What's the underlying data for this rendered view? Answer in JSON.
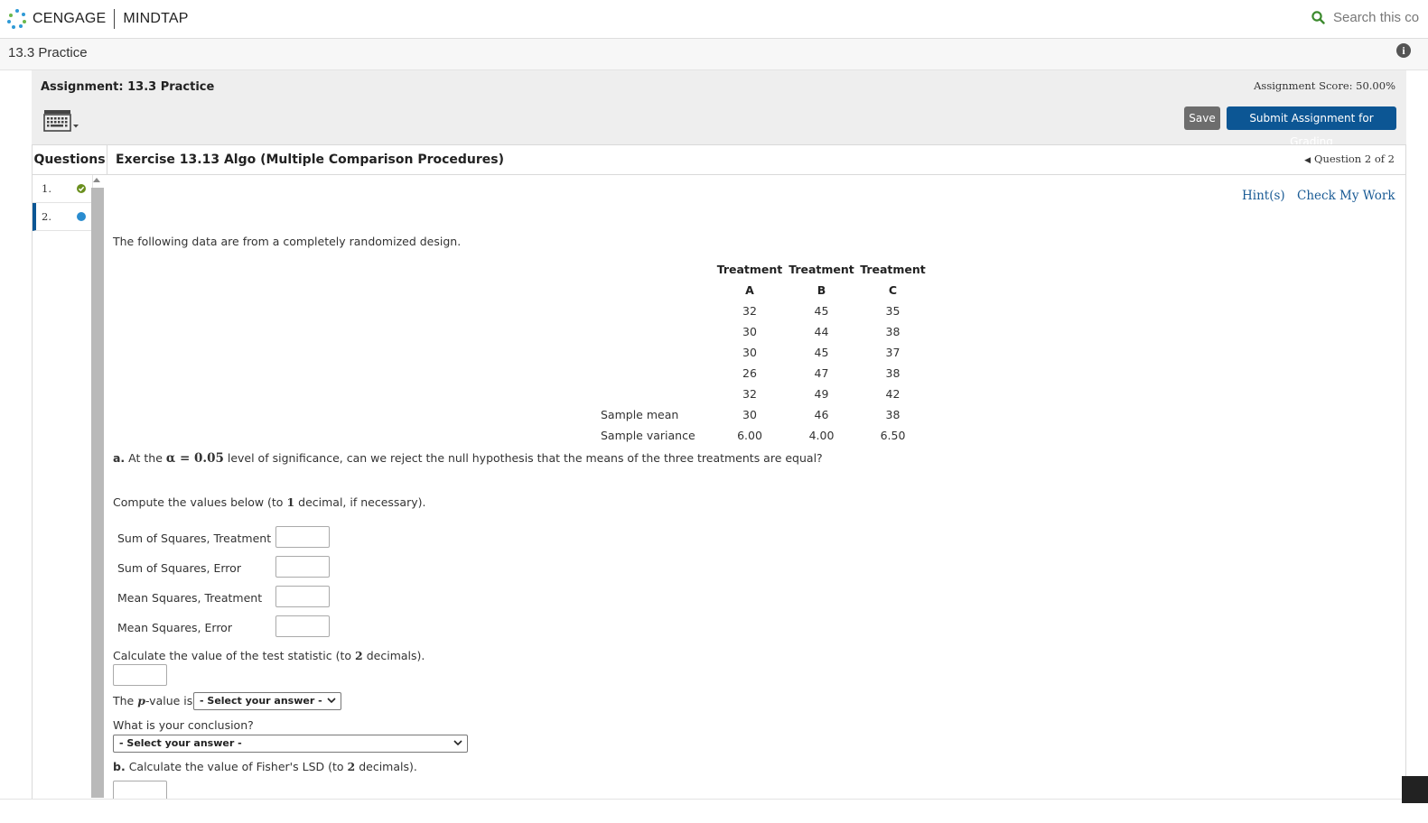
{
  "topbar": {
    "brand": "CENGAGE",
    "product": "MINDTAP",
    "search_placeholder": "Search this co"
  },
  "subbar": {
    "title": "13.3 Practice"
  },
  "header": {
    "assignment_title": "Assignment: 13.3 Practice",
    "score": "Assignment Score: 50.00%",
    "save_label": "Save",
    "submit_label": "Submit Assignment for Grading"
  },
  "questions_panel": {
    "heading": "Questions",
    "items": [
      {
        "label": "1.",
        "status": "complete",
        "status_color": "#6a8f1e"
      },
      {
        "label": "2.",
        "status": "current",
        "status_color": "#2a8ccf"
      }
    ]
  },
  "exercise": {
    "title": "Exercise 13.13 Algo (Multiple Comparison Procedures)",
    "question_count": "Question 2 of 2",
    "hints_label": "Hint(s)",
    "check_work_label": "Check My Work",
    "intro": "The following data are from a completely randomized design.",
    "table": {
      "header_row1": [
        "Treatment",
        "Treatment",
        "Treatment"
      ],
      "header_row2": [
        "A",
        "B",
        "C"
      ],
      "rows": [
        [
          "32",
          "45",
          "35"
        ],
        [
          "30",
          "44",
          "38"
        ],
        [
          "30",
          "45",
          "37"
        ],
        [
          "26",
          "47",
          "38"
        ],
        [
          "32",
          "49",
          "42"
        ]
      ],
      "mean_label": "Sample mean",
      "means": [
        "30",
        "46",
        "38"
      ],
      "variance_label": "Sample variance",
      "variances": [
        "6.00",
        "4.00",
        "6.50"
      ]
    },
    "part_a": {
      "prefix": "a.",
      "text_before": "At the",
      "alpha": "α = 0.05",
      "text_after": "level of significance, can we reject the null hypothesis that the means of the three treatments are equal?",
      "compute_before": "Compute the values below (to",
      "compute_num": "1",
      "compute_after": "decimal, if necessary).",
      "fields": [
        {
          "label": "Sum of Squares, Treatment",
          "value": ""
        },
        {
          "label": "Sum of Squares, Error",
          "value": ""
        },
        {
          "label": "Mean Squares, Treatment",
          "value": ""
        },
        {
          "label": "Mean Squares, Error",
          "value": ""
        }
      ],
      "test_stat_before": "Calculate the value of the test statistic (to",
      "test_stat_num": "2",
      "test_stat_after": "decimals).",
      "pvalue_before": "The",
      "pvalue_p": "p",
      "pvalue_after": "-value is",
      "pvalue_select": "- Select your answer -",
      "conclusion_q": "What is your conclusion?",
      "conclusion_select": "- Select your answer -"
    },
    "part_b": {
      "prefix": "b.",
      "text_before": "Calculate the value of Fisher's LSD (to",
      "num": "2",
      "text_after": "decimals)."
    }
  },
  "colors": {
    "brand_blue": "#0c5694",
    "link_blue": "#1a5b95",
    "save_gray": "#6d6d6d",
    "search_icon_green": "#3c8a2e"
  }
}
